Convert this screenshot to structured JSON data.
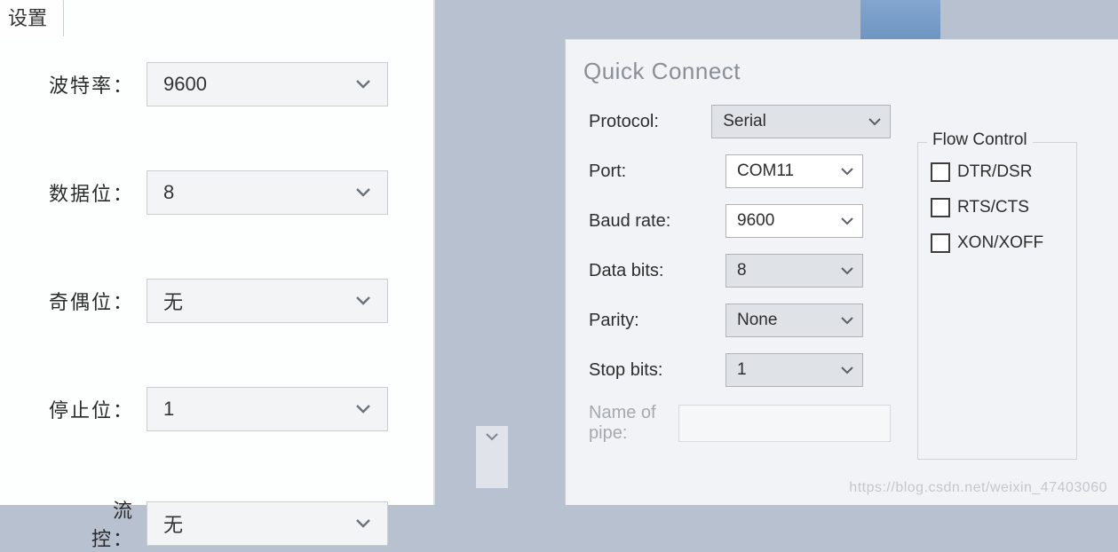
{
  "left_panel": {
    "tab_label": "设置",
    "fields": {
      "baud_rate": {
        "label": "波特率：",
        "value": "9600"
      },
      "data_bits": {
        "label": "数据位：",
        "value": "8"
      },
      "parity": {
        "label": "奇偶位：",
        "value": "无"
      },
      "stop_bits": {
        "label": "停止位：",
        "value": "1"
      },
      "flow_ctrl": {
        "label": "流控：",
        "value": "无"
      }
    }
  },
  "dialog": {
    "title": "Quick Connect",
    "fields": {
      "protocol": {
        "label": "Protocol:",
        "value": "Serial"
      },
      "port": {
        "label": "Port:",
        "value": "COM11"
      },
      "baud_rate": {
        "label": "Baud rate:",
        "value": "9600"
      },
      "data_bits": {
        "label": "Data bits:",
        "value": "8"
      },
      "parity": {
        "label": "Parity:",
        "value": "None"
      },
      "stop_bits": {
        "label": "Stop bits:",
        "value": "1"
      },
      "pipe": {
        "label": "Name of pipe:",
        "value": ""
      }
    },
    "flow_control": {
      "legend": "Flow Control",
      "options": {
        "dtr_dsr": {
          "label": "DTR/DSR",
          "checked": false
        },
        "rts_cts": {
          "label": "RTS/CTS",
          "checked": false
        },
        "xon_xoff": {
          "label": "XON/XOFF",
          "checked": false
        }
      }
    }
  },
  "watermark": "https://blog.csdn.net/weixin_47403060"
}
